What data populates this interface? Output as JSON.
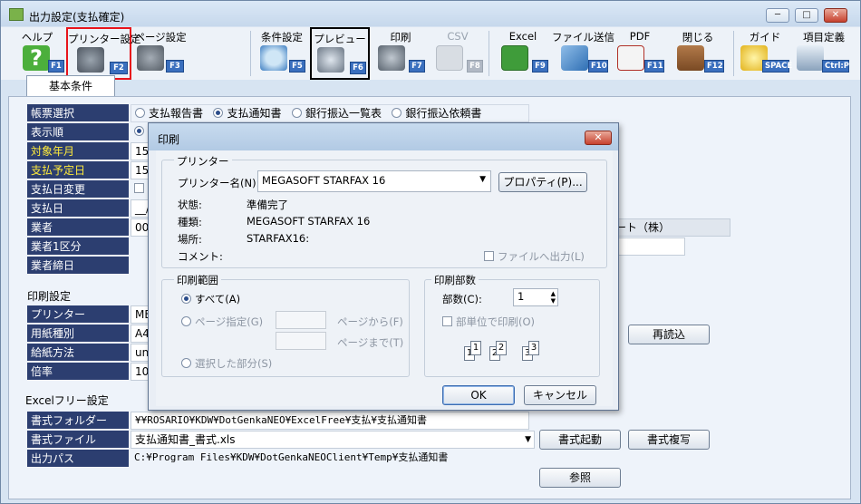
{
  "window": {
    "title": "出力設定(支払確定)",
    "min_glyph": "─",
    "max_glyph": "□",
    "close_glyph": "✕"
  },
  "toolbar": {
    "help": {
      "label": "ヘルプ",
      "key": "F1",
      "icon": "question-icon"
    },
    "printer_settings": {
      "label": "プリンター設定",
      "key": "F2",
      "icon": "printer-settings-icon"
    },
    "page_settings": {
      "label": "ページ設定",
      "key": "F3",
      "icon": "page-settings-icon"
    },
    "conditions": {
      "label": "条件設定",
      "key": "F5",
      "icon": "magnifier-icon"
    },
    "preview": {
      "label": "プレビュー",
      "key": "F6",
      "icon": "preview-icon"
    },
    "print": {
      "label": "印刷",
      "key": "F7",
      "icon": "print-icon"
    },
    "csv": {
      "label": "CSV",
      "key": "F8",
      "icon": "csv-icon"
    },
    "excel": {
      "label": "Excel",
      "key": "F9",
      "icon": "excel-icon"
    },
    "file_send": {
      "label": "ファイル送信",
      "key": "F10",
      "icon": "mail-icon"
    },
    "pdf": {
      "label": "PDF",
      "key": "F11",
      "icon": "pdf-icon"
    },
    "close": {
      "label": "閉じる",
      "key": "F12",
      "icon": "door-icon"
    },
    "guide": {
      "label": "ガイド",
      "key": "SPACE",
      "icon": "bulb-icon"
    },
    "item_def": {
      "label": "項目定義",
      "key": "Ctrl:P",
      "icon": "item-def-icon"
    }
  },
  "tabs": {
    "basic": "基本条件"
  },
  "basic": {
    "labels": [
      "帳票選択",
      "表示順",
      "対象年月",
      "支払予定日",
      "支払日変更",
      "支払日",
      "業者",
      "業者1区分",
      "業者締日"
    ],
    "report_options": [
      "支払報告書",
      "支払通知書",
      "銀行振込一覧表",
      "銀行振込依頼書"
    ],
    "selected_report": "支払通知書",
    "target_month_partial": "15/",
    "pay_date_partial": "15/",
    "pay_date_value": "__/",
    "vendor_code_partial": "000",
    "vendor_name_partial": "ート（株）"
  },
  "print_settings": {
    "section": "印刷設定",
    "labels": [
      "プリンター",
      "用紙種別",
      "給紙方法",
      "倍率"
    ],
    "printer_partial": "ME(",
    "paper_partial": "A4",
    "feed_partial": "unl",
    "ratio_partial": "10",
    "reload_button": "再読込"
  },
  "excel_free": {
    "section": "Excelフリー設定",
    "labels": [
      "書式フォルダー",
      "書式ファイル",
      "出力パス"
    ],
    "folder": "¥¥ROSARIO¥KDW¥DotGenkaNEO¥ExcelFree¥支払¥支払通知書",
    "file": "支払通知書_書式.xls",
    "output": "C:¥Program Files¥KDW¥DotGenkaNEOClient¥Temp¥支払通知書",
    "launch_button": "書式起動",
    "copy_button": "書式複写",
    "browse_button": "参照"
  },
  "print_dialog": {
    "title": "印刷",
    "printer_group": "プリンター",
    "printer_name_label": "プリンター名(N):",
    "printer_name_value": "MEGASOFT STARFAX 16",
    "properties_button": "プロパティ(P)...",
    "status_label": "状態:",
    "status_value": "準備完了",
    "type_label": "種類:",
    "type_value": "MEGASOFT STARFAX 16",
    "where_label": "場所:",
    "where_value": "STARFAX16:",
    "comment_label": "コメント:",
    "print_to_file": "ファイルへ出力(L)",
    "range_group": "印刷範囲",
    "range_all": "すべて(A)",
    "range_pages": "ページ指定(G)",
    "page_from": "ページから(F)",
    "page_to": "ページまで(T)",
    "range_selection": "選択した部分(S)",
    "copies_group": "印刷部数",
    "copies_label": "部数(C):",
    "copies_value": "1",
    "collate_label": "部単位で印刷(O)",
    "collate_pages": [
      "1",
      "1",
      "2",
      "2",
      "3",
      "3"
    ],
    "ok_button": "OK",
    "cancel_button": "キャンセル"
  }
}
